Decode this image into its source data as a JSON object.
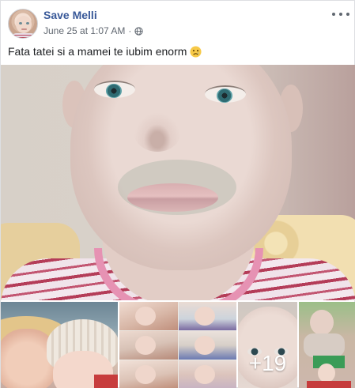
{
  "post": {
    "author_name": "Save Melli",
    "date": "June 25 at 1:07 AM",
    "separator": "·",
    "privacy_icon": "globe-icon",
    "more_icon": "more-options-icon",
    "caption": "Fata tatei si a mamei te iubim enorm",
    "caption_emoji": "sad-face-emoji",
    "extra_photos_count": "+19"
  },
  "colors": {
    "author_link": "#385898",
    "meta_text": "#606770",
    "body_text": "#1c1e21"
  }
}
